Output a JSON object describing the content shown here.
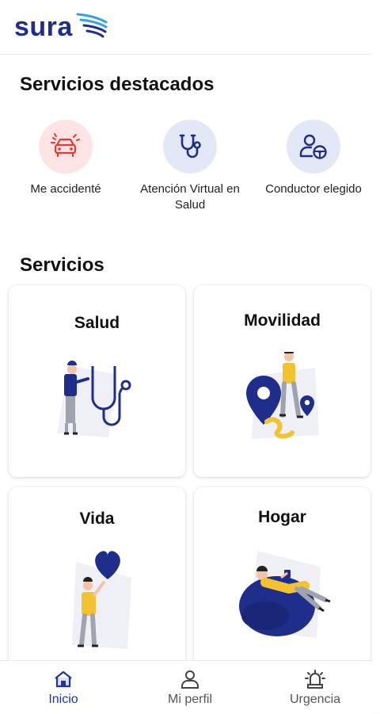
{
  "app": {
    "logo_text": "sura"
  },
  "featured": {
    "title": "Servicios destacados",
    "items": [
      {
        "label": "Me accidenté",
        "icon": "car-crash-icon",
        "color": "#e53935",
        "bg": "#fde3e3"
      },
      {
        "label": "Atención Virtual en Salud",
        "icon": "stethoscope-icon",
        "color": "#1e2e8a",
        "bg": "#e3e8f7"
      },
      {
        "label": "Conductor elegido",
        "icon": "driver-icon",
        "color": "#1e2e8a",
        "bg": "#e3e8f7"
      }
    ]
  },
  "services": {
    "title": "Servicios",
    "cards": [
      {
        "title": "Salud"
      },
      {
        "title": "Movilidad"
      },
      {
        "title": "Vida"
      },
      {
        "title": "Hogar"
      }
    ]
  },
  "nav": {
    "items": [
      {
        "label": "Inicio",
        "icon": "home-icon",
        "active": true
      },
      {
        "label": "Mi perfil",
        "icon": "profile-icon",
        "active": false
      },
      {
        "label": "Urgencia",
        "icon": "siren-icon",
        "active": false
      }
    ]
  },
  "colors": {
    "brand": "#1e2e8a",
    "accent_yellow": "#f2c230",
    "active_nav": "#2033a8"
  }
}
